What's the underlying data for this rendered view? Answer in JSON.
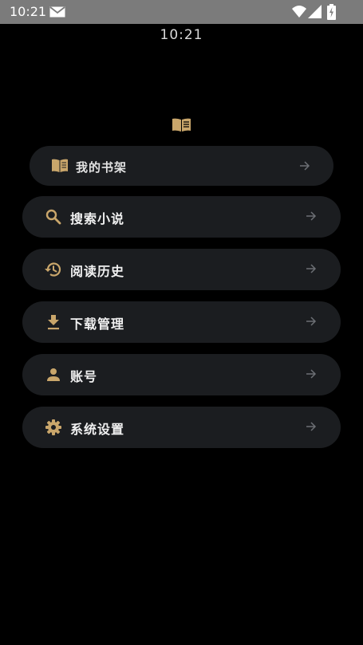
{
  "status_bar": {
    "time": "10:21"
  },
  "clock": "10:21",
  "menu": [
    {
      "label": "我的书架",
      "icon": "book-icon"
    },
    {
      "label": "搜索小说",
      "icon": "search-icon"
    },
    {
      "label": "阅读历史",
      "icon": "history-icon"
    },
    {
      "label": "下载管理",
      "icon": "download-icon"
    },
    {
      "label": "账号",
      "icon": "person-icon"
    },
    {
      "label": "系统设置",
      "icon": "gear-icon"
    }
  ],
  "colors": {
    "accent": "#c9a66b",
    "card": "#1b1d20",
    "background": "#000000"
  }
}
